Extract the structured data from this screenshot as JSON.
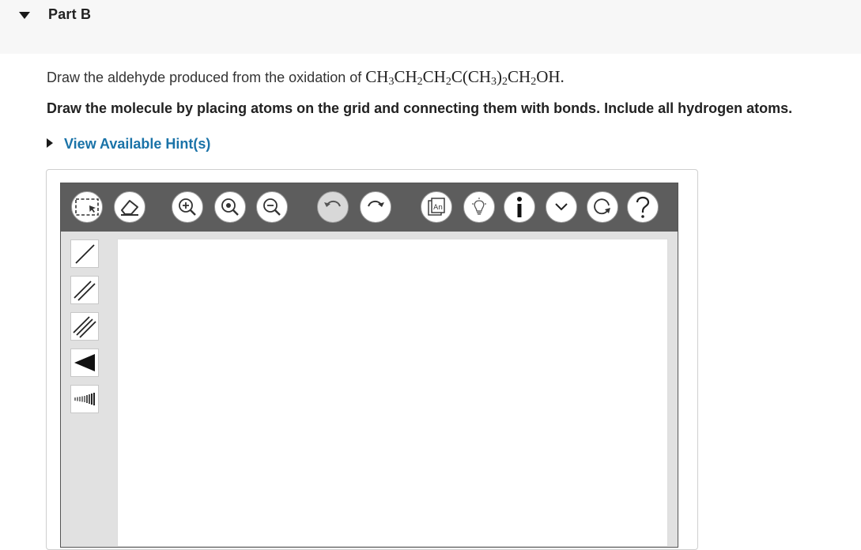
{
  "part": {
    "title": "Part B"
  },
  "question": {
    "prompt": "Draw the aldehyde produced from the oxidation of",
    "formula_text": "CH3CH2CH2C(CH3)2CH2OH.",
    "formula_parts": [
      "CH",
      "3",
      "CH",
      "2",
      "CH",
      "2",
      "C(CH",
      "3",
      ")",
      "2",
      "CH",
      "2",
      "OH."
    ],
    "instruction": "Draw the molecule by placing atoms on the grid and connecting them with bonds. Include all hydrogen atoms.",
    "hint_link": "View Available Hint(s)"
  },
  "toolbar": {
    "tools": [
      {
        "name": "select-icon",
        "state": "enabled"
      },
      {
        "name": "eraser-icon",
        "state": "enabled"
      },
      {
        "name": "zoom-in-icon",
        "state": "enabled"
      },
      {
        "name": "zoom-fit-icon",
        "state": "enabled"
      },
      {
        "name": "zoom-out-icon",
        "state": "enabled"
      },
      {
        "name": "undo-icon",
        "state": "disabled"
      },
      {
        "name": "redo-icon",
        "state": "enabled"
      },
      {
        "name": "template-icon",
        "state": "enabled",
        "label": "An"
      },
      {
        "name": "lightbulb-icon",
        "state": "enabled"
      },
      {
        "name": "info-icon",
        "state": "enabled",
        "label": "i"
      },
      {
        "name": "chevron-down-icon",
        "state": "enabled"
      },
      {
        "name": "reset-icon",
        "state": "enabled"
      },
      {
        "name": "help-icon",
        "state": "enabled",
        "label": "?"
      }
    ]
  },
  "side_tools": [
    {
      "name": "single-bond-icon"
    },
    {
      "name": "double-bond-icon"
    },
    {
      "name": "triple-bond-icon"
    },
    {
      "name": "wedge-bond-icon"
    },
    {
      "name": "hash-bond-icon"
    }
  ],
  "colors": {
    "header_bg": "#f7f7f7",
    "link": "#1a73a8",
    "toolbar_bg": "#5d5d5d",
    "sidebar_bg": "#e1e1e1"
  }
}
